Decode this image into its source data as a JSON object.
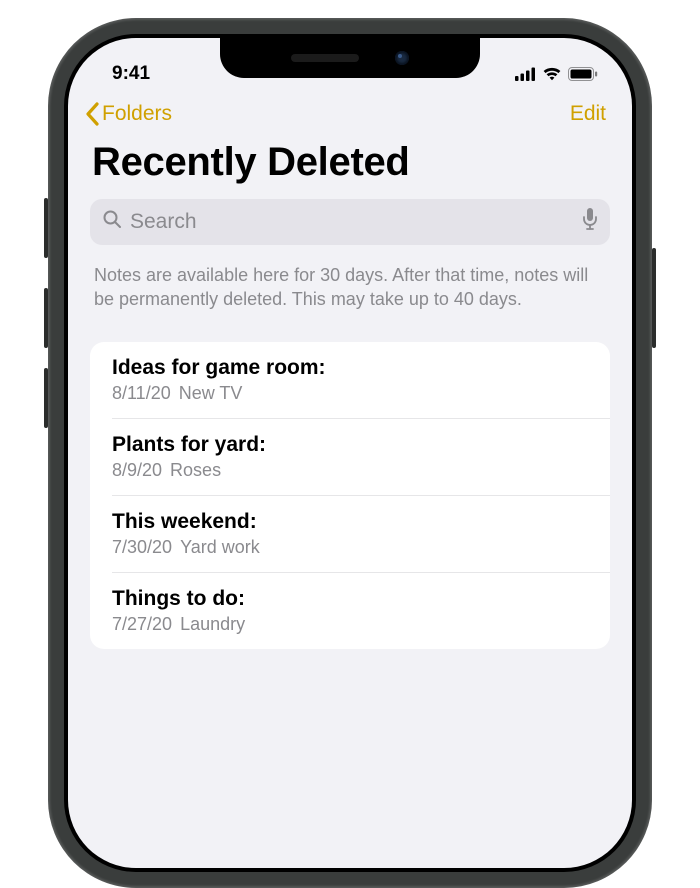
{
  "status": {
    "time": "9:41"
  },
  "nav": {
    "back_label": "Folders",
    "edit_label": "Edit"
  },
  "title": "Recently Deleted",
  "search": {
    "placeholder": "Search"
  },
  "info": "Notes are available here for 30 days. After that time, notes will be permanently deleted. This may take up to 40 days.",
  "notes": [
    {
      "title": "Ideas for game room:",
      "date": "8/11/20",
      "preview": "New TV"
    },
    {
      "title": "Plants for yard:",
      "date": "8/9/20",
      "preview": "Roses"
    },
    {
      "title": "This weekend:",
      "date": "7/30/20",
      "preview": "Yard work"
    },
    {
      "title": "Things to do:",
      "date": "7/27/20",
      "preview": "Laundry"
    }
  ]
}
